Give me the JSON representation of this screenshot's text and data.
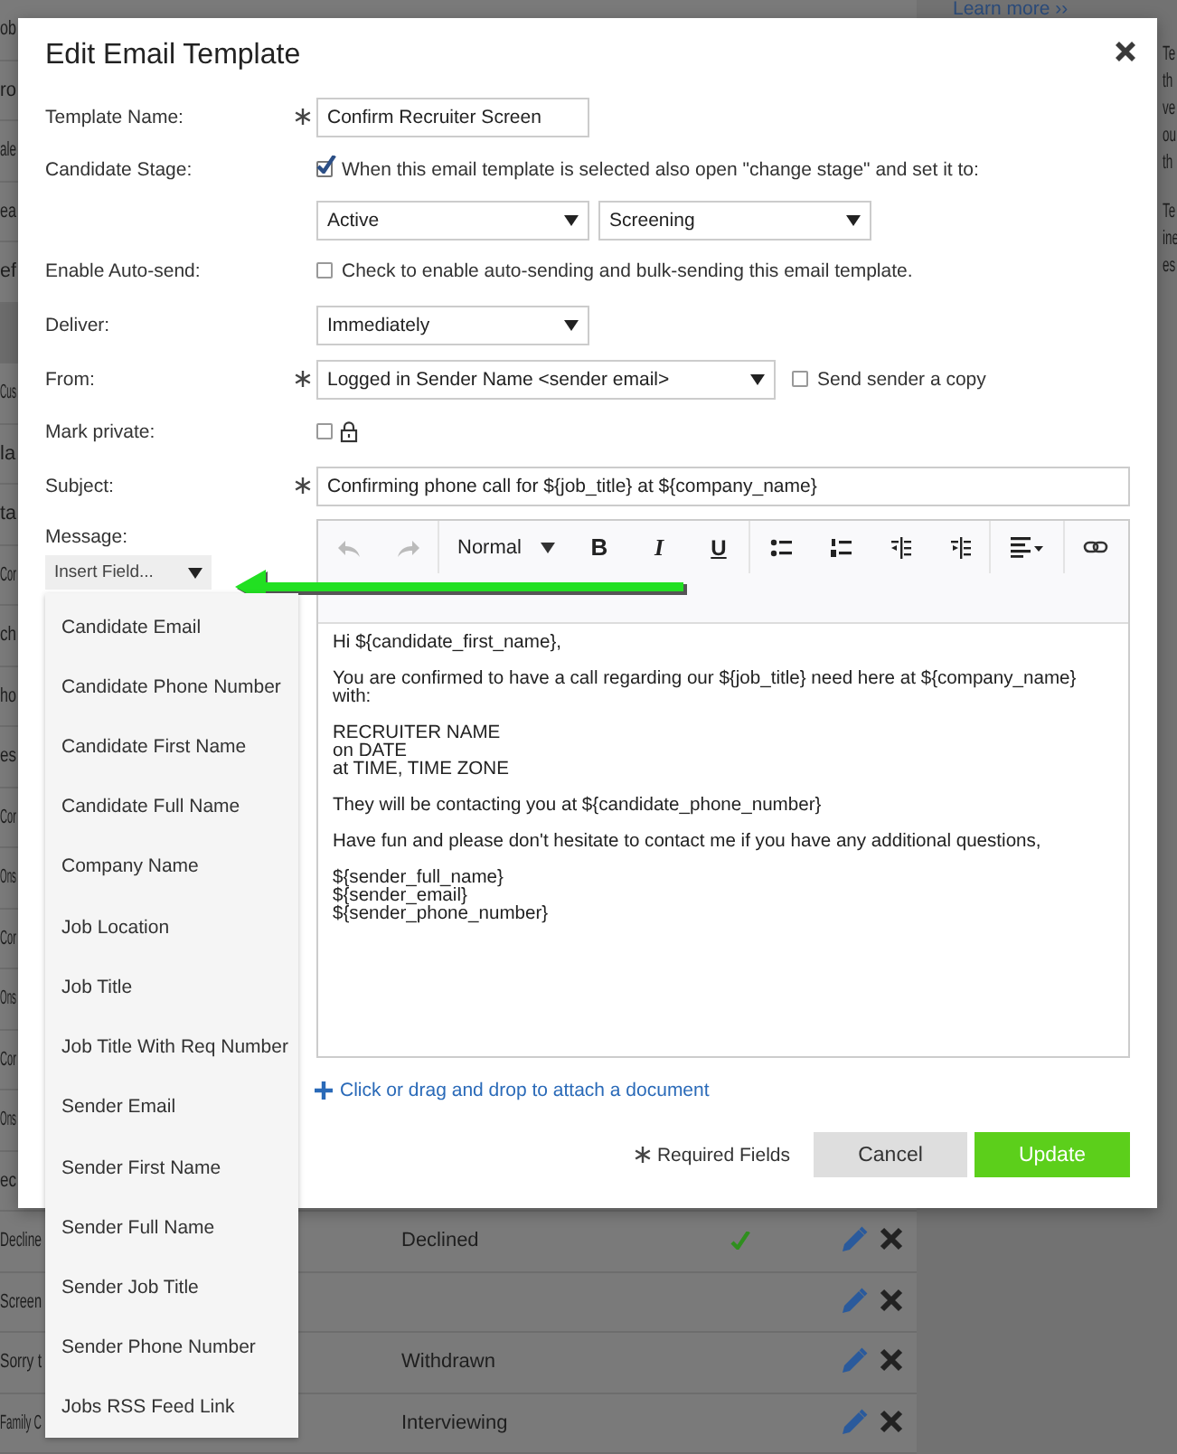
{
  "background_page": {
    "learn_more_link": "Learn more ››",
    "rows": [
      {
        "kind": "fragment",
        "column_1": "ob"
      },
      {
        "kind": "fragment",
        "column_1": "ro"
      },
      {
        "kind": "fragment",
        "column_1": "ale"
      },
      {
        "kind": "fragment",
        "column_1": "ea"
      },
      {
        "kind": "fragment",
        "column_1": "ef"
      },
      {
        "kind": "group"
      },
      {
        "kind": "fragment",
        "column_1": "Cus"
      },
      {
        "kind": "fragment",
        "column_1": "la"
      },
      {
        "kind": "fragment",
        "column_1": "ta"
      },
      {
        "kind": "fragment",
        "column_1": "Cor"
      },
      {
        "kind": "fragment",
        "column_1": "ch"
      },
      {
        "kind": "fragment",
        "column_1": "ho"
      },
      {
        "kind": "fragment",
        "column_1": "es"
      },
      {
        "kind": "fragment",
        "column_1": "Cor"
      },
      {
        "kind": "fragment",
        "column_1": "Ons"
      },
      {
        "kind": "fragment",
        "column_1": "Cor"
      },
      {
        "kind": "fragment",
        "column_1": "Ons"
      },
      {
        "kind": "fragment",
        "column_1": "Cor"
      },
      {
        "kind": "fragment",
        "column_1": "Ons"
      },
      {
        "kind": "fragment",
        "column_1": "ec"
      },
      {
        "kind": "full",
        "column_1": "Decline",
        "column_2": "Declined",
        "checked": true
      },
      {
        "kind": "full",
        "column_1": "Screen",
        "checked": false
      },
      {
        "kind": "full",
        "column_1": "Sorry t",
        "column_2": "Withdrawn",
        "checked": false
      },
      {
        "kind": "full",
        "column_1": "Family C",
        "column_2": "Interviewing",
        "checked": false
      }
    ],
    "side_paragraphs": [
      [
        "Te",
        "th",
        "ve",
        "ou",
        "th"
      ],
      [
        "Te",
        "ine",
        "es"
      ]
    ]
  },
  "dialog": {
    "title": "Edit Email Template",
    "fields": [
      {
        "kind": "text",
        "label": "Template Name:",
        "required": true,
        "value": "Confirm Recruiter Screen"
      },
      {
        "kind": "stage",
        "label": "Candidate Stage:",
        "checked": true,
        "checkbox_label": "When this email template is selected also open \"change stage\" and set it to:",
        "selects": [
          "Active",
          "Screening"
        ]
      },
      {
        "kind": "checkbox",
        "label": "Enable Auto-send:",
        "checked": false,
        "checkbox_label": "Check to enable auto-sending and bulk-sending this email template."
      },
      {
        "kind": "select",
        "label": "Deliver:",
        "value": "Immediately"
      },
      {
        "kind": "from",
        "label": "From:",
        "required": true,
        "value": "Logged in Sender Name <sender email>",
        "checked": false,
        "checkbox_label": "Send sender a copy"
      },
      {
        "kind": "private",
        "label": "Mark private:",
        "checked": false
      },
      {
        "kind": "wide_text",
        "label": "Subject:",
        "required": true,
        "value": "Confirming phone call for ${job_title} at ${company_name}"
      }
    ],
    "message": {
      "label": "Message:",
      "insert_field": "Insert Field...",
      "field_options": [
        "Candidate Email",
        "Candidate Phone Number",
        "Candidate First Name",
        "Candidate Full Name",
        "Company Name",
        "Job Location",
        "Job Title",
        "Job Title With Req Number",
        "Sender Email",
        "Sender First Name",
        "Sender Full Name",
        "Sender Job Title",
        "Sender Phone Number",
        "Jobs RSS Feed Link"
      ],
      "toolbar": [
        {
          "kind": "undo"
        },
        {
          "kind": "redo"
        },
        {
          "kind": "format",
          "label": "Normal"
        },
        {
          "kind": "bold",
          "label": "B"
        },
        {
          "kind": "italic",
          "label": "I"
        },
        {
          "kind": "underline",
          "label": "U"
        },
        {
          "kind": "bullet_list"
        },
        {
          "kind": "numbered_list"
        },
        {
          "kind": "outdent"
        },
        {
          "kind": "indent"
        },
        {
          "kind": "align"
        },
        {
          "kind": "link"
        }
      ],
      "body": [
        [
          "Hi ${candidate_first_name},"
        ],
        [
          "You are confirmed to have a call regarding our ${job_title} need here at ${company_name} with:"
        ],
        [
          "RECRUITER NAME",
          "on DATE",
          "at TIME, TIME ZONE"
        ],
        [
          "They will be contacting you at ${candidate_phone_number}"
        ],
        [
          "Have fun and please don't hesitate to contact me if you have any additional questions,"
        ],
        [
          "${sender_full_name}",
          "${sender_email}",
          "${sender_phone_number}"
        ]
      ]
    },
    "attach_link": "Click or drag and drop to attach a document",
    "required_note": "Required Fields",
    "buttons": [
      {
        "kind": "cancel",
        "label": "Cancel"
      },
      {
        "kind": "primary",
        "label": "Update"
      }
    ]
  }
}
